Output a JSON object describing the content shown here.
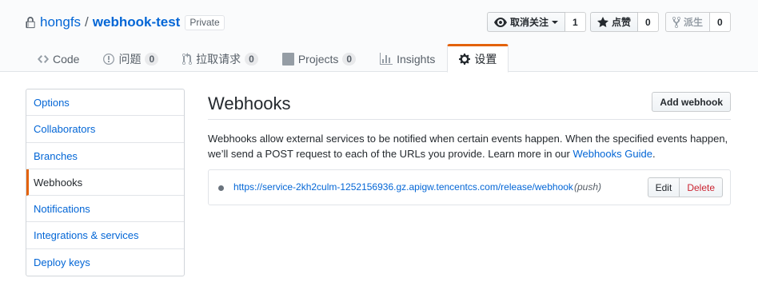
{
  "repo": {
    "owner": "hongfs",
    "separator": "/",
    "name": "webhook-test",
    "visibility": "Private"
  },
  "actions": {
    "watch_label": "取消关注",
    "watch_count": "1",
    "star_label": "点赞",
    "star_count": "0",
    "fork_label": "派生",
    "fork_count": "0"
  },
  "tabs": [
    {
      "label": "Code",
      "counter": null,
      "icon": "code-icon"
    },
    {
      "label": "问题",
      "counter": "0",
      "icon": "issue-icon"
    },
    {
      "label": "拉取请求",
      "counter": "0",
      "icon": "pull-request-icon"
    },
    {
      "label": "Projects",
      "counter": "0",
      "icon": "project-icon"
    },
    {
      "label": "Insights",
      "counter": null,
      "icon": "graph-icon"
    },
    {
      "label": "设置",
      "counter": null,
      "icon": "gear-icon",
      "selected": true
    }
  ],
  "sidebar": {
    "items": [
      {
        "label": "Options"
      },
      {
        "label": "Collaborators"
      },
      {
        "label": "Branches"
      },
      {
        "label": "Webhooks",
        "selected": true
      },
      {
        "label": "Notifications"
      },
      {
        "label": "Integrations & services"
      },
      {
        "label": "Deploy keys"
      }
    ]
  },
  "main": {
    "title": "Webhooks",
    "add_button": "Add webhook",
    "description_1": "Webhooks allow external services to be notified when certain events happen. When the specified events happen, we’ll send a POST request to each of the URLs you provide. Learn more in our ",
    "guide_link": "Webhooks Guide",
    "description_end": ".",
    "hook": {
      "url": "https://service-2kh2culm-1252156936.gz.apigw.tencentcs.com/release/webhook",
      "event": "(push)",
      "edit_label": "Edit",
      "delete_label": "Delete"
    }
  },
  "colors": {
    "link": "#0366d6",
    "accent": "#e36209",
    "danger": "#cb2431"
  }
}
